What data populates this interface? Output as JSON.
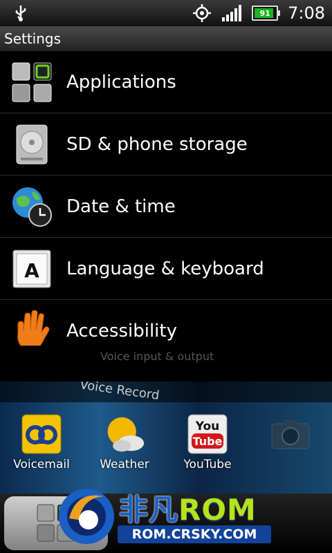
{
  "status_bar": {
    "usb_icon": "usb-icon",
    "gps_icon": "gps-icon",
    "signal_icon": "signal-icon",
    "battery": "91",
    "battery_level": 0.91,
    "time": "7:08"
  },
  "header": {
    "title": "Settings"
  },
  "settings": {
    "items": [
      {
        "label": "Applications",
        "icon": "applications-icon"
      },
      {
        "label": "SD & phone storage",
        "icon": "storage-icon"
      },
      {
        "label": "Date & time",
        "icon": "date-time-icon"
      },
      {
        "label": "Language & keyboard",
        "icon": "language-icon"
      },
      {
        "label": "Accessibility",
        "icon": "accessibility-icon"
      }
    ]
  },
  "background": {
    "voice_input": "Voice input & output",
    "voice_recorder": "Voice Record"
  },
  "home": {
    "apps": [
      {
        "label": "Voicemail",
        "icon": "voicemail-icon"
      },
      {
        "label": "Weather",
        "icon": "weather-icon"
      },
      {
        "label": "YouTube",
        "icon": "youtube-icon"
      },
      {
        "label": "",
        "icon": "camera-icon"
      }
    ]
  },
  "watermark": {
    "brand_cn": "非凡",
    "brand_rom": "ROM",
    "url": "ROM.CRSKY.COM"
  },
  "colors": {
    "battery_green": "#1ab51a",
    "watermark_green": "#b6e31a",
    "watermark_blue": "#12429a"
  }
}
